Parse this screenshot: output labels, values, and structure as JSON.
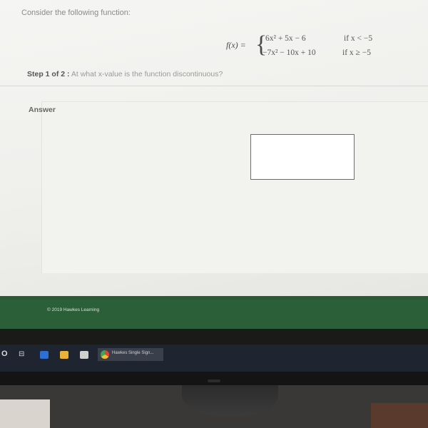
{
  "question": {
    "prompt": "Consider the following function:",
    "function_label": "f(x) =",
    "brace": "{",
    "pieces": [
      {
        "expression": "6x² + 5x − 6",
        "condition": "if x < −5"
      },
      {
        "expression": "−7x² − 10x + 10",
        "condition": "if x ≥ −5"
      }
    ],
    "step_label": "Step 1 of 2 :",
    "step_text": "At what x-value is the function discontinuous?"
  },
  "answer": {
    "label": "Answer",
    "value": ""
  },
  "footer": {
    "copyright": "© 2019 Hawkes Learning"
  },
  "taskbar": {
    "start_icon": "windows-start-icon",
    "search_glyph": "O",
    "task_view_glyph": "⊟",
    "window_label": "Hawkes Single Sign..."
  }
}
